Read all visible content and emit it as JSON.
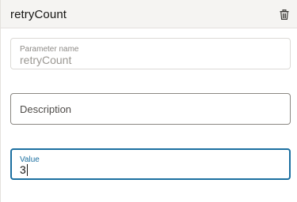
{
  "header": {
    "title": "retryCount",
    "delete_icon": "trash-icon"
  },
  "parameter_name": {
    "label": "Parameter name",
    "value": "retryCount"
  },
  "description": {
    "placeholder": "Description",
    "value": ""
  },
  "value_field": {
    "label": "Value",
    "value": "3"
  },
  "colors": {
    "header_bg": "#f5f4f2",
    "focus_accent": "#1b6fa0",
    "border_default": "#8a8782",
    "border_disabled": "#dcdad6"
  }
}
